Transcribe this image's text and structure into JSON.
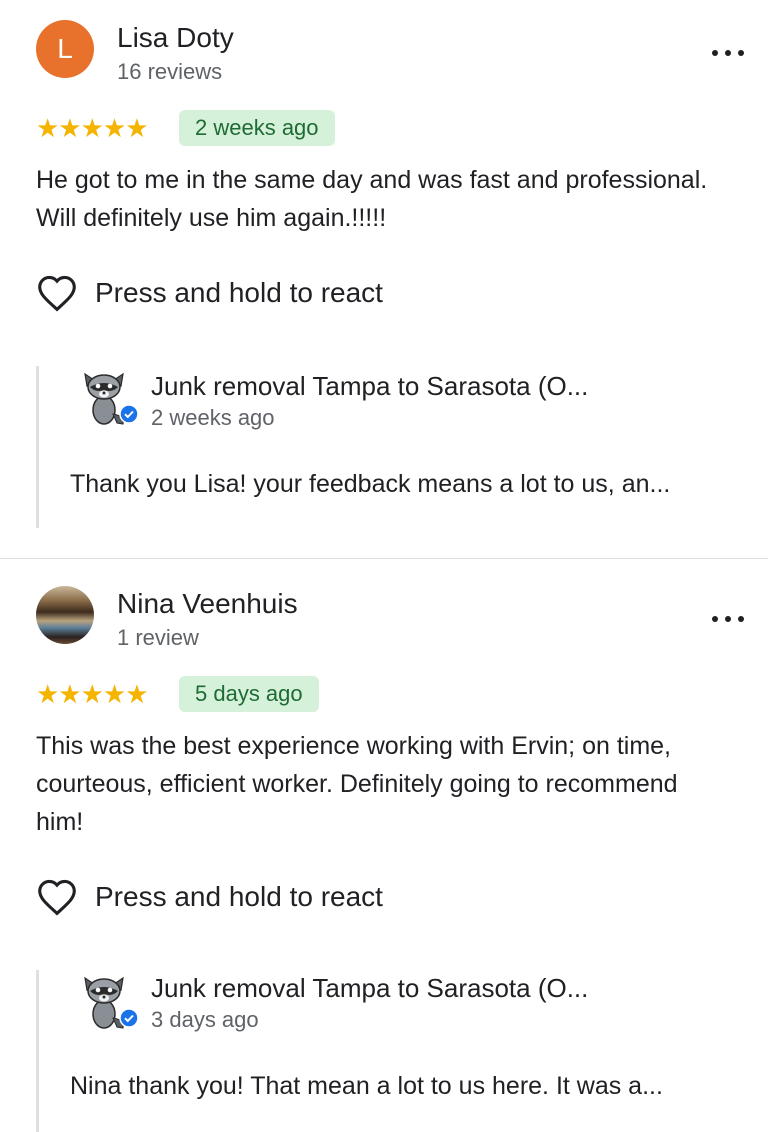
{
  "reviews": [
    {
      "avatar_letter": "L",
      "avatar_color": "#e8722c",
      "name": "Lisa Doty",
      "review_count": "16 reviews",
      "stars": "★★★★★",
      "rating": 5,
      "date": "2 weeks ago",
      "text": "He got to me in the same day and was fast and professional. Will definitely use him again.!!!!!",
      "react_label": "Press and hold to react",
      "reply": {
        "owner_name": "Junk removal Tampa to Sarasota (O...",
        "date": "2 weeks ago",
        "text": "Thank you Lisa! your feedback means a lot to us, an..."
      }
    },
    {
      "avatar_letter": "",
      "name": "Nina Veenhuis",
      "review_count": "1 review",
      "stars": "★★★★★",
      "rating": 5,
      "date": "5 days ago",
      "text": "This was the best experience working with Ervin; on time, courteous, efficient worker. Definitely going to recommend him!",
      "react_label": "Press and hold to react",
      "reply": {
        "owner_name": "Junk removal Tampa to Sarasota (O...",
        "date": "3 days ago",
        "text": "Nina thank you! That mean a lot to us here. It was a..."
      }
    }
  ],
  "colors": {
    "star": "#f4b400",
    "badge_bg": "#d6f1d9",
    "badge_text": "#1e6b35",
    "verified": "#1a73e8"
  },
  "icons": {
    "more": "more-vert-icon",
    "react": "heart-outline-icon",
    "verified": "verified-check-icon"
  }
}
